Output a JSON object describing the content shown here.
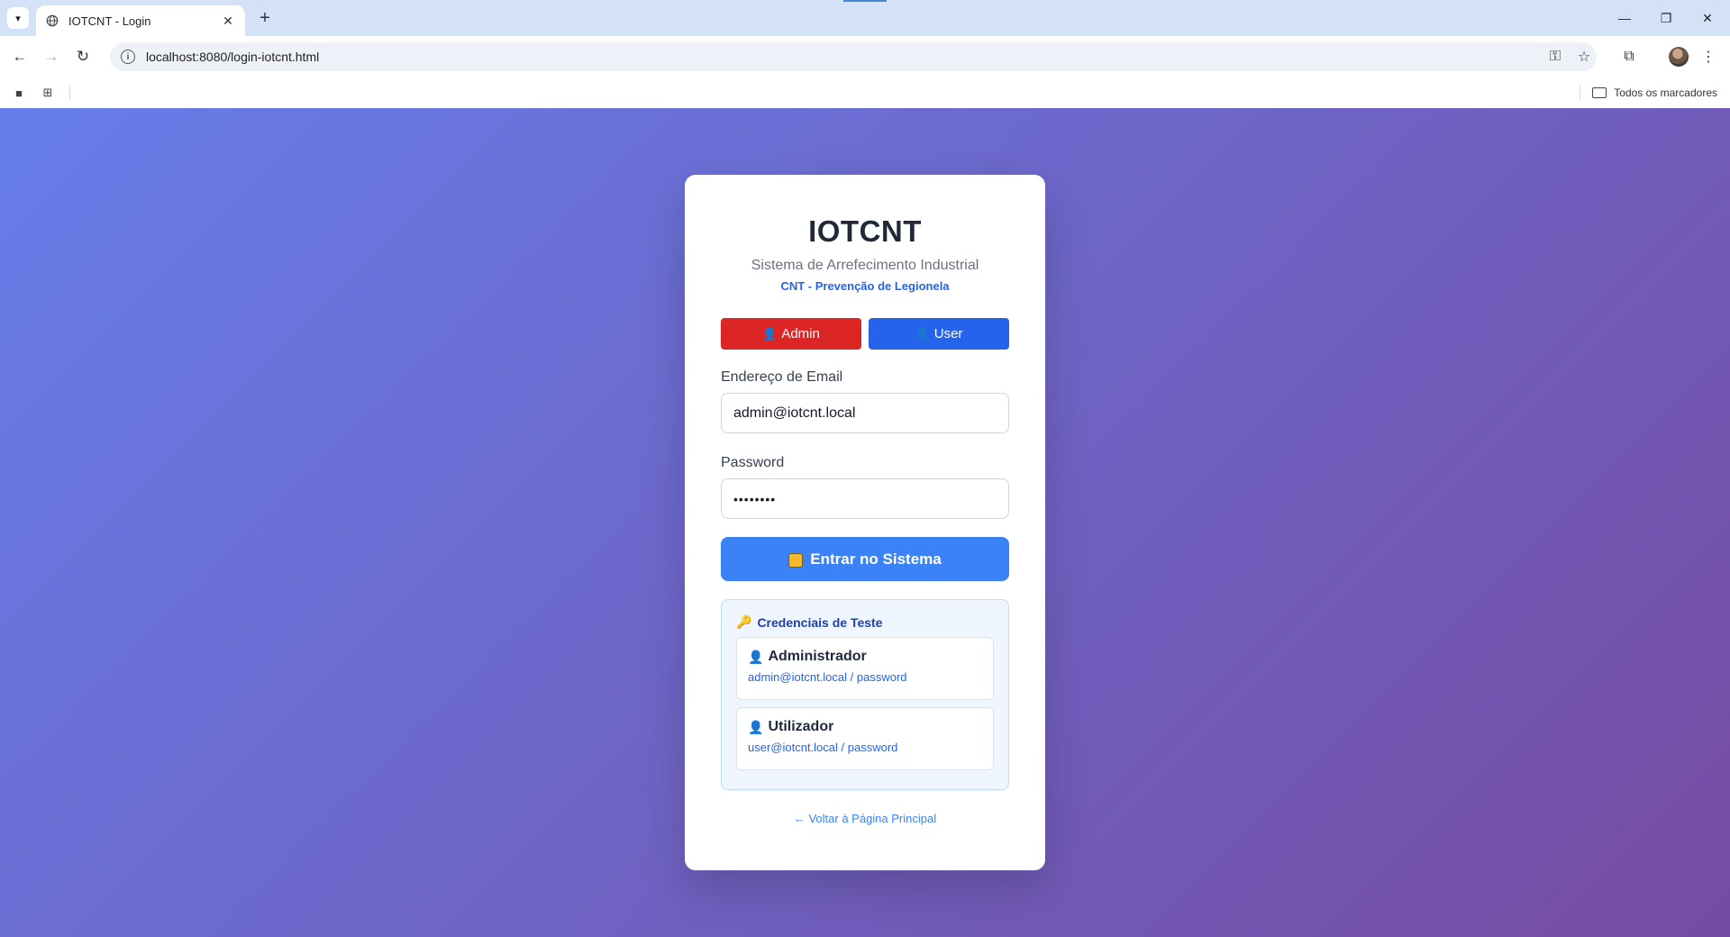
{
  "browser": {
    "tab_title": "IOTCNT - Login",
    "url": "localhost:8080/login-iotcnt.html",
    "bookmarks_folder": "Todos os marcadores"
  },
  "login": {
    "brand": "IOTCNT",
    "subtitle": "Sistema de Arrefecimento Industrial",
    "subtitle2": "CNT - Prevenção de Legionela",
    "role_admin": "Admin",
    "role_user": "User",
    "email_label": "Endereço de Email",
    "email_value": "admin@iotcnt.local",
    "password_label": "Password",
    "password_value": "••••••••",
    "submit_label": "Entrar no Sistema",
    "test_title": "Credenciais de Teste",
    "credentials": [
      {
        "name": "Administrador",
        "line": "admin@iotcnt.local / password"
      },
      {
        "name": "Utilizador",
        "line": "user@iotcnt.local / password"
      }
    ],
    "back_link": "← Voltar à Página Principal"
  },
  "colors": {
    "gradient_start": "#667eea",
    "gradient_end": "#764ba2",
    "admin_button": "#dc2626",
    "user_button": "#2563eb",
    "submit_button": "#3b82f6"
  },
  "icons": {
    "role_admin": "person-icon",
    "role_user": "person-icon",
    "submit": "lock-icon",
    "test_title": "key-icon"
  }
}
